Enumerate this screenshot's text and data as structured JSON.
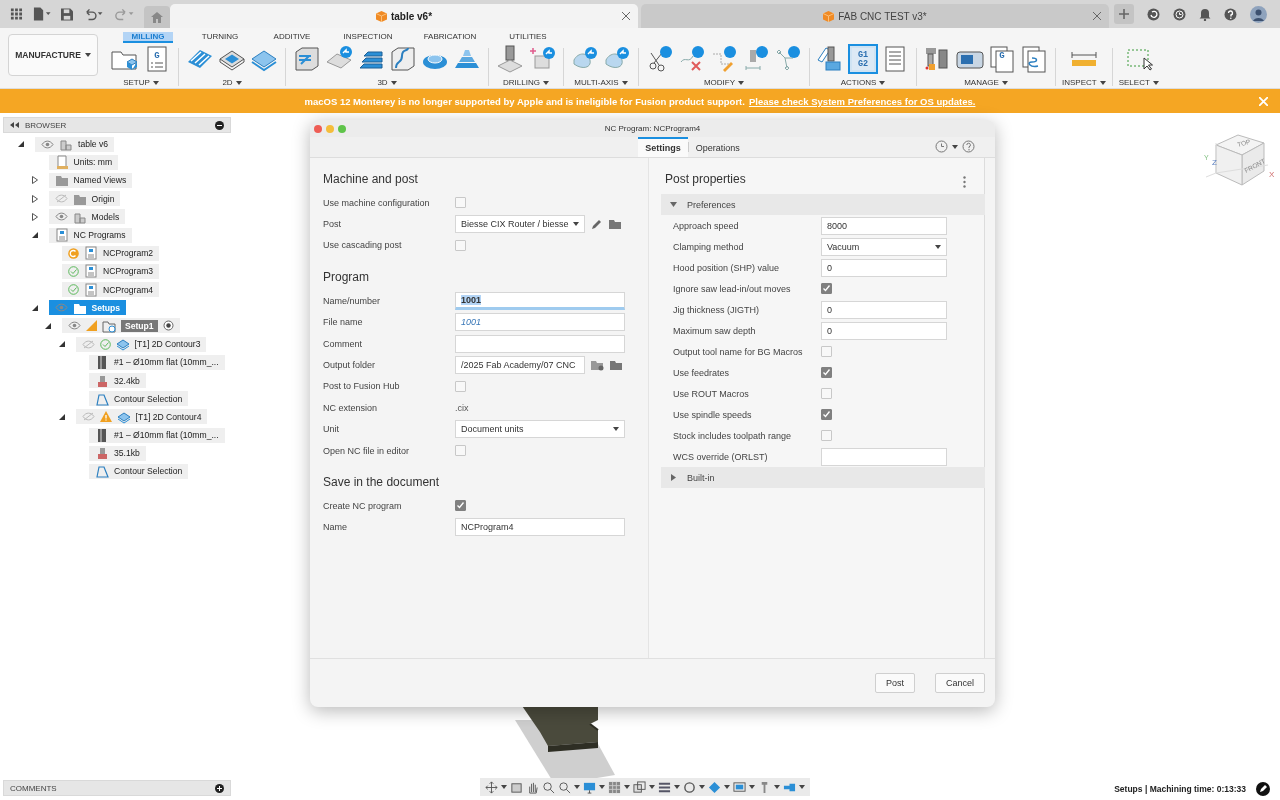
{
  "app_tabs": [
    {
      "title": "table v6*",
      "selected": true
    },
    {
      "title": "FAB CNC TEST v3*",
      "selected": false
    }
  ],
  "workspace": "MANUFACTURE",
  "ribbon_tabs": [
    {
      "label": "MILLING",
      "selected": true
    },
    {
      "label": "TURNING",
      "selected": false
    },
    {
      "label": "ADDITIVE",
      "selected": false
    },
    {
      "label": "INSPECTION",
      "selected": false
    },
    {
      "label": "FABRICATION",
      "selected": false
    },
    {
      "label": "UTILITIES",
      "selected": false
    }
  ],
  "ribbon_groups": [
    {
      "label": "SETUP",
      "tools": [
        {
          "kind": "folder",
          "highlighted": false
        },
        {
          "kind": "g-sheet",
          "text": [
            "G"
          ],
          "highlighted": false
        }
      ]
    },
    {
      "label": "2D",
      "tools": [
        {
          "kind": "stripes",
          "highlighted": false
        },
        {
          "kind": "diamond-rings",
          "highlighted": false
        },
        {
          "kind": "tile",
          "highlighted": false
        }
      ]
    },
    {
      "label": "3D",
      "tools": [
        {
          "kind": "box-lines",
          "highlighted": false
        },
        {
          "kind": "plate-badge",
          "highlighted": false
        },
        {
          "kind": "steps",
          "highlighted": false
        },
        {
          "kind": "wave-box",
          "highlighted": false
        },
        {
          "kind": "dome",
          "highlighted": false
        },
        {
          "kind": "terrace",
          "highlighted": false
        }
      ]
    },
    {
      "label": "DRILLING",
      "tools": [
        {
          "kind": "drill",
          "highlighted": false
        },
        {
          "kind": "plus-badge",
          "highlighted": false
        }
      ]
    },
    {
      "label": "MULTI-AXIS",
      "tools": [
        {
          "kind": "blob-badge",
          "highlighted": false
        },
        {
          "kind": "blob-badge",
          "highlighted": false
        }
      ]
    },
    {
      "label": "MODIFY",
      "tools": [
        {
          "kind": "scissors-badge",
          "highlighted": false
        },
        {
          "kind": "cross-badge",
          "highlighted": false
        },
        {
          "kind": "pencil-badge",
          "highlighted": false
        },
        {
          "kind": "tool-badge",
          "highlighted": false
        },
        {
          "kind": "nodes-badge",
          "highlighted": false
        }
      ]
    },
    {
      "label": "ACTIONS",
      "tools": [
        {
          "kind": "tool-plate",
          "highlighted": false
        },
        {
          "kind": "code-card",
          "text": [
            "G1",
            "G2"
          ],
          "highlighted": true
        },
        {
          "kind": "document",
          "highlighted": false
        }
      ]
    },
    {
      "label": "MANAGE",
      "tools": [
        {
          "kind": "machine-tools",
          "highlighted": false
        },
        {
          "kind": "machine",
          "highlighted": false
        },
        {
          "kind": "g-pages",
          "text": [
            "G"
          ],
          "highlighted": false
        },
        {
          "kind": "pages",
          "highlighted": false
        }
      ]
    },
    {
      "label": "INSPECT",
      "tools": [
        {
          "kind": "ruler",
          "highlighted": false
        }
      ]
    },
    {
      "label": "SELECT",
      "tools": [
        {
          "kind": "marquee",
          "highlighted": false
        }
      ]
    }
  ],
  "banner": {
    "message": "macOS 12 Monterey is no longer supported by Apple and is ineligible for Fusion product support.",
    "link": "Please check System Preferences for OS updates."
  },
  "browser": {
    "title": "BROWSER",
    "tree": [
      {
        "label": "table v6",
        "kind": "component",
        "visible": true,
        "expanded": true,
        "selected": false,
        "children": [
          {
            "label": "Units: mm",
            "kind": "units",
            "selected": false
          },
          {
            "label": "Named Views",
            "kind": "folder",
            "expanded": false,
            "selected": false
          },
          {
            "label": "Origin",
            "kind": "folder",
            "visible": false,
            "expanded": false,
            "selected": false
          },
          {
            "label": "Models",
            "kind": "component",
            "visible": true,
            "expanded": false,
            "selected": false
          },
          {
            "label": "NC Programs",
            "kind": "nc",
            "expanded": true,
            "selected": false,
            "children": [
              {
                "label": "NCProgram2",
                "kind": "nc",
                "complete": false,
                "selected": false
              },
              {
                "label": "NCProgram3",
                "kind": "nc",
                "complete": true,
                "selected": false
              },
              {
                "label": "NCProgram4",
                "kind": "nc",
                "complete": true,
                "selected": false
              }
            ]
          },
          {
            "label": "Setups",
            "kind": "setups",
            "visible": true,
            "expanded": true,
            "selected": true,
            "active": false,
            "children": [
              {
                "label": "Setup1",
                "kind": "setup",
                "visible": true,
                "expanded": true,
                "selected": false,
                "active": true,
                "children": [
                  {
                    "label": "[T1] 2D Contour3",
                    "kind": "operation",
                    "visible": false,
                    "complete": true,
                    "expanded": true,
                    "selected": false,
                    "children": [
                      {
                        "label": "#1 – Ø10mm flat (10mm_...",
                        "kind": "tool",
                        "selected": false
                      },
                      {
                        "label": "32.4kb",
                        "kind": "file",
                        "selected": false
                      },
                      {
                        "label": "Contour Selection",
                        "kind": "contour",
                        "selected": false
                      }
                    ]
                  },
                  {
                    "label": "[T1] 2D Contour4",
                    "kind": "operation",
                    "visible": false,
                    "complete": false,
                    "expanded": true,
                    "selected": false,
                    "children": [
                      {
                        "label": "#1 – Ø10mm flat (10mm_...",
                        "kind": "tool",
                        "selected": false
                      },
                      {
                        "label": "35.1kb",
                        "kind": "file",
                        "selected": false
                      },
                      {
                        "label": "Contour Selection",
                        "kind": "contour",
                        "selected": false
                      }
                    ]
                  }
                ]
              }
            ]
          }
        ]
      }
    ]
  },
  "comments": {
    "title": "COMMENTS"
  },
  "dialog": {
    "title": "NC Program: NCProgram4",
    "tabs": [
      {
        "label": "Settings",
        "selected": true
      },
      {
        "label": "Operations",
        "selected": false
      }
    ],
    "sections": [
      {
        "heading": "Machine and post",
        "rows": [
          {
            "label": "Use machine configuration",
            "kind": "checkbox",
            "checked": false
          },
          {
            "label": "Post",
            "kind": "select-browse",
            "value": "Biesse CIX Router / biesse"
          },
          {
            "label": "Use cascading post",
            "kind": "checkbox",
            "checked": false
          }
        ]
      },
      {
        "heading": "Program",
        "rows": [
          {
            "label": "Name/number",
            "kind": "text",
            "value": "1001",
            "focused": true
          },
          {
            "label": "File name",
            "kind": "text",
            "placeholder": "1001",
            "focused": false
          },
          {
            "label": "Comment",
            "kind": "text",
            "focused": false
          },
          {
            "label": "Output folder",
            "kind": "text-browse",
            "value": "/2025 Fab Academy/07 CNC"
          },
          {
            "label": "Post to Fusion Hub",
            "kind": "checkbox",
            "checked": false
          },
          {
            "label": "NC extension",
            "kind": "static",
            "value": ".cix"
          },
          {
            "label": "Unit",
            "kind": "select",
            "value": "Document units"
          },
          {
            "label": "Open NC file in editor",
            "kind": "checkbox",
            "checked": false
          }
        ]
      },
      {
        "heading": "Save in the document",
        "rows": [
          {
            "label": "Create NC program",
            "kind": "checkbox",
            "checked": true
          },
          {
            "label": "Name",
            "kind": "text",
            "value": "NCProgram4",
            "focused": false
          }
        ]
      }
    ],
    "post_properties": {
      "heading": "Post properties",
      "groups": [
        {
          "label": "Preferences",
          "expanded": true,
          "rows": [
            {
              "label": "Approach speed",
              "kind": "text",
              "value": "8000"
            },
            {
              "label": "Clamping method",
              "kind": "select",
              "value": "Vacuum"
            },
            {
              "label": "Hood position (SHP) value",
              "kind": "text",
              "value": "0"
            },
            {
              "label": "Ignore saw lead-in/out moves",
              "kind": "checkbox",
              "checked": true
            },
            {
              "label": "Jig thickness (JIGTH)",
              "kind": "text",
              "value": "0"
            },
            {
              "label": "Maximum saw depth",
              "kind": "text",
              "value": "0"
            },
            {
              "label": "Output tool name for BG Macros",
              "kind": "checkbox",
              "checked": false
            },
            {
              "label": "Use feedrates",
              "kind": "checkbox",
              "checked": true
            },
            {
              "label": "Use ROUT Macros",
              "kind": "checkbox",
              "checked": false
            },
            {
              "label": "Use spindle speeds",
              "kind": "checkbox",
              "checked": true
            },
            {
              "label": "Stock includes toolpath range",
              "kind": "checkbox",
              "checked": false
            },
            {
              "label": "WCS override (ORLST)",
              "kind": "text"
            }
          ]
        },
        {
          "label": "Built-in",
          "expanded": false
        }
      ]
    },
    "buttons": [
      "Post",
      "Cancel"
    ]
  },
  "view_cube": {
    "top": "TOP",
    "front": "FRONT",
    "axes": [
      "Z",
      "Y",
      "X"
    ]
  },
  "status_bar": "Setups | Machining time: 0:13:33"
}
